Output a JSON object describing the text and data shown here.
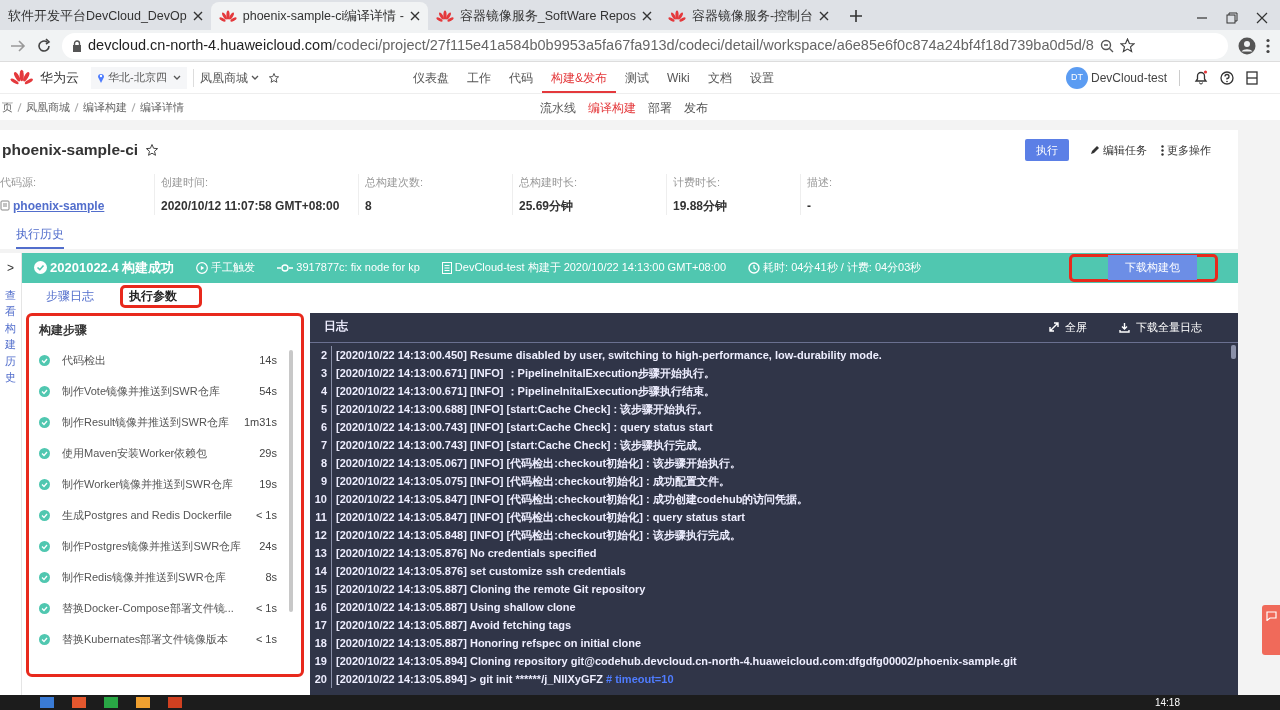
{
  "browser": {
    "tabs": [
      {
        "title": "软件开发平台DevCloud_DevOp",
        "selected": false
      },
      {
        "title": "phoenix-sample-ci编译详情 -",
        "selected": true
      },
      {
        "title": "容器镜像服务_SoftWare Repos",
        "selected": false
      },
      {
        "title": "容器镜像服务-控制台",
        "selected": false
      }
    ],
    "url_host": "devcloud.cn-north-4.huaweicloud.com",
    "url_path": "/codeci/project/27f115e41a584b0b9953a5fa67fa913d/codeci/detail/workspace/a6e85e6f0c874a24bf4f18d739ba0d5d/8"
  },
  "header": {
    "brand": "华为云",
    "region": "华北-北京四",
    "project": "凤凰商城",
    "nav": [
      {
        "label": "仪表盘",
        "selected": false
      },
      {
        "label": "工作",
        "selected": false
      },
      {
        "label": "代码",
        "selected": false
      },
      {
        "label": "构建&发布",
        "selected": true
      },
      {
        "label": "测试",
        "selected": false
      },
      {
        "label": "Wiki",
        "selected": false
      },
      {
        "label": "文档",
        "selected": false
      },
      {
        "label": "设置",
        "selected": false
      }
    ],
    "user_initials": "DT",
    "user": "DevCloud-test"
  },
  "breadcrumb": [
    "页",
    "凤凰商城",
    "编译构建",
    "编译详情"
  ],
  "subnav": [
    {
      "label": "流水线",
      "selected": false
    },
    {
      "label": "编译构建",
      "selected": true
    },
    {
      "label": "部署",
      "selected": false
    },
    {
      "label": "发布",
      "selected": false
    }
  ],
  "job": {
    "title": "phoenix-sample-ci",
    "actions": [
      {
        "label": "执行",
        "kind": "primary"
      },
      {
        "label": "编辑任务",
        "kind": "edit"
      },
      {
        "label": "更多操作",
        "kind": "more"
      }
    ],
    "info": [
      {
        "label": "代码源:",
        "value": "phoenix-sample",
        "kind": "repo"
      },
      {
        "label": "创建时间:",
        "value": "2020/10/12 11:07:58 GMT+08:00",
        "kind": "text"
      },
      {
        "label": "总构建次数:",
        "value": "8",
        "kind": "text"
      },
      {
        "label": "总构建时长:",
        "value": "25.69分钟",
        "kind": "text"
      },
      {
        "label": "计费时长:",
        "value": "19.88分钟",
        "kind": "text"
      },
      {
        "label": "描述:",
        "value": "-",
        "kind": "text"
      }
    ],
    "history_tab": "执行历史"
  },
  "build": {
    "succeeded": true,
    "number": "20201022.4 构建成功",
    "trigger": "手工触发",
    "commit": "3917877c:  fix node for kp",
    "builder": "DevCloud-test 构建于 2020/10/22 14:13:00 GMT+08:00",
    "duration": "耗时:  04分41秒  / 计费:  04分03秒",
    "download": {
      "label": "下载构建包",
      "highlighted": true
    }
  },
  "side_toggle": ">",
  "side_label": "查看构建历史",
  "subtabs": [
    {
      "label": "步骤日志",
      "selected": false,
      "highlighted": false
    },
    {
      "label": "执行参数",
      "selected": true,
      "highlighted": true
    }
  ],
  "steps": {
    "title": "构建步骤",
    "highlighted": true,
    "items": [
      {
        "name": "代码检出",
        "time": "14s",
        "completed": true
      },
      {
        "name": "制作Vote镜像并推送到SWR仓库",
        "time": "54s",
        "completed": true
      },
      {
        "name": "制作Result镜像并推送到SWR仓库",
        "time": "1m31s",
        "completed": true
      },
      {
        "name": "使用Maven安装Worker依赖包",
        "time": "29s",
        "completed": true
      },
      {
        "name": "制作Worker镜像并推送到SWR仓库",
        "time": "19s",
        "completed": true
      },
      {
        "name": "生成Postgres and Redis Dockerfile",
        "time": "< 1s",
        "completed": true
      },
      {
        "name": "制作Postgres镜像并推送到SWR仓库",
        "time": "24s",
        "completed": true
      },
      {
        "name": "制作Redis镜像并推送到SWR仓库",
        "time": "8s",
        "completed": true
      },
      {
        "name": "替换Docker-Compose部署文件镜...",
        "time": "< 1s",
        "completed": true
      },
      {
        "name": "替换Kubernates部署文件镜像版本",
        "time": "< 1s",
        "completed": true
      }
    ]
  },
  "log": {
    "title": "日志",
    "fullscreen": "全屏",
    "download": "下载全量日志",
    "lines": [
      {
        "no": "2",
        "text": "[2020/10/22 14:13:00.450] Resume disabled by user, switching to high-performance, low-durability mode."
      },
      {
        "no": "3",
        "text": "[2020/10/22 14:13:00.671] [INFO] ：PipelineInitalExecution步骤开始执行。"
      },
      {
        "no": "4",
        "text": "[2020/10/22 14:13:00.671] [INFO] ：PipelineInitalExecution步骤执行结束。"
      },
      {
        "no": "5",
        "text": "[2020/10/22 14:13:00.688] [INFO] [start:Cache Check] : 该步骤开始执行。"
      },
      {
        "no": "6",
        "text": "[2020/10/22 14:13:00.743] [INFO] [start:Cache Check] : query status start"
      },
      {
        "no": "7",
        "text": "[2020/10/22 14:13:00.743] [INFO] [start:Cache Check] : 该步骤执行完成。"
      },
      {
        "no": "8",
        "text": "[2020/10/22 14:13:05.067] [INFO] [代码检出:checkout初始化] : 该步骤开始执行。"
      },
      {
        "no": "9",
        "text": "[2020/10/22 14:13:05.075] [INFO] [代码检出:checkout初始化] : 成功配置文件。"
      },
      {
        "no": "10",
        "text": "[2020/10/22 14:13:05.847] [INFO] [代码检出:checkout初始化] : 成功创建codehub的访问凭据。"
      },
      {
        "no": "11",
        "text": "[2020/10/22 14:13:05.847] [INFO] [代码检出:checkout初始化] : query status start"
      },
      {
        "no": "12",
        "text": "[2020/10/22 14:13:05.848] [INFO] [代码检出:checkout初始化] : 该步骤执行完成。"
      },
      {
        "no": "13",
        "text": "[2020/10/22 14:13:05.876] No credentials specified"
      },
      {
        "no": "14",
        "text": "[2020/10/22 14:13:05.876] set customize ssh credentials"
      },
      {
        "no": "15",
        "text": "[2020/10/22 14:13:05.887] Cloning the remote Git repository"
      },
      {
        "no": "16",
        "text": "[2020/10/22 14:13:05.887] Using shallow clone"
      },
      {
        "no": "17",
        "text": "[2020/10/22 14:13:05.887] Avoid fetching tags"
      },
      {
        "no": "18",
        "text": "[2020/10/22 14:13:05.887] Honoring refspec on initial clone"
      },
      {
        "no": "19",
        "text": "[2020/10/22 14:13:05.894] Cloning repository git@codehub.devcloud.cn-north-4.huaweicloud.com:dfgdfg00002/phoenix-sample.git"
      },
      {
        "no": "20",
        "text": "[2020/10/22 14:13:05.894]  > git init ******/j_NllXyGFZ",
        "comment": "# timeout=10"
      }
    ]
  },
  "taskbar": {
    "clock": "14:18"
  }
}
